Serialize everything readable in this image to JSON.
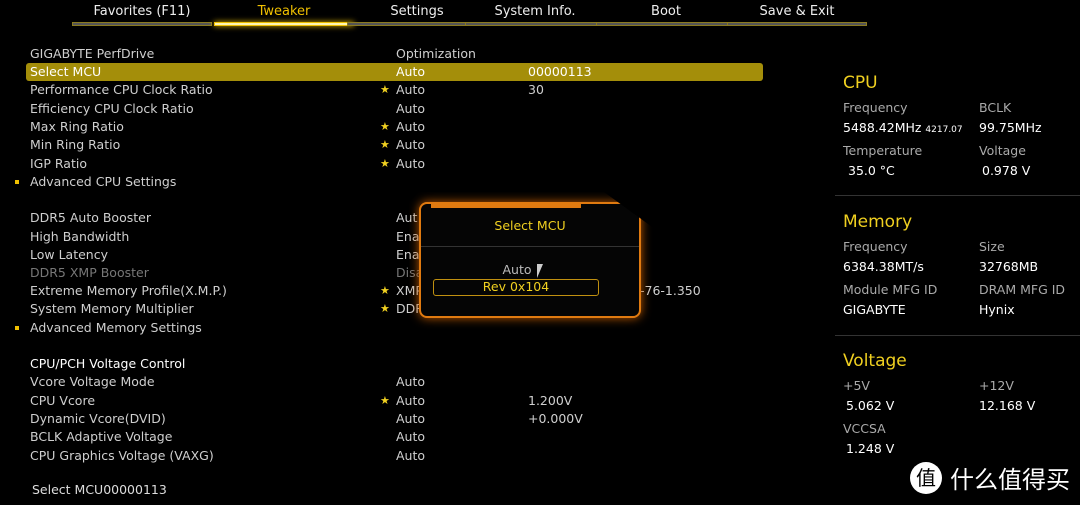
{
  "tabs": [
    {
      "label": "Favorites (F11)"
    },
    {
      "label": "Tweaker",
      "active": true
    },
    {
      "label": "Settings"
    },
    {
      "label": "System Info."
    },
    {
      "label": "Boot"
    },
    {
      "label": "Save & Exit"
    }
  ],
  "rows": [
    {
      "label": "GIGABYTE PerfDrive",
      "value": "Optimization"
    },
    {
      "label": "Select MCU",
      "value": "Auto",
      "extra": "00000113"
    },
    {
      "label": "Performance CPU Clock Ratio",
      "star": "★",
      "value": "Auto",
      "extra": "30"
    },
    {
      "label": "Efficiency CPU Clock Ratio",
      "value": "Auto"
    },
    {
      "label": "Max Ring Ratio",
      "star": "★",
      "value": "Auto"
    },
    {
      "label": "Min Ring Ratio",
      "star": "★",
      "value": "Auto"
    },
    {
      "label": "IGP Ratio",
      "star": "★",
      "value": "Auto"
    },
    {
      "label": "Advanced CPU Settings"
    },
    {
      "label": "DDR5 Auto Booster",
      "value": "Aut"
    },
    {
      "label": "High Bandwidth",
      "value": "Ena"
    },
    {
      "label": "Low Latency",
      "value": "Ena"
    },
    {
      "label": "DDR5 XMP Booster",
      "value": "Disa"
    },
    {
      "label": "Extreme Memory Profile(X.M.P.)",
      "star": "★",
      "value": "XMP",
      "extra": "-76-1.350"
    },
    {
      "label": "System Memory Multiplier",
      "star": "★",
      "value": "DDR"
    },
    {
      "label": "Advanced Memory Settings"
    },
    {
      "label": "CPU/PCH Voltage Control"
    },
    {
      "label": "Vcore Voltage Mode",
      "value": "Auto"
    },
    {
      "label": "CPU Vcore",
      "star": "★",
      "value": "Auto",
      "extra": "1.200V"
    },
    {
      "label": "Dynamic Vcore(DVID)",
      "value": "Auto",
      "extra": "+0.000V"
    },
    {
      "label": "BCLK Adaptive Voltage",
      "value": "Auto"
    },
    {
      "label": "CPU Graphics Voltage (VAXG)",
      "value": "Auto"
    }
  ],
  "status": "Select MCU00000113",
  "popup": {
    "title": "Select MCU",
    "options": [
      "Auto",
      "Rev 0x104"
    ]
  },
  "side": {
    "cpu": {
      "title": "CPU",
      "freq_label": "Frequency",
      "freq": "5488.42MHz",
      "freq_sub": "4217.07",
      "bclk_label": "BCLK",
      "bclk": "99.75MHz",
      "temp_label": "Temperature",
      "temp": "35.0 °C",
      "volt_label": "Voltage",
      "volt": "0.978 V"
    },
    "memory": {
      "title": "Memory",
      "freq_label": "Frequency",
      "freq": "6384.38MT/s",
      "size_label": "Size",
      "size": "32768MB",
      "mod_label": "Module MFG ID",
      "mod": "GIGABYTE",
      "dram_label": "DRAM MFG ID",
      "dram": "Hynix"
    },
    "voltage": {
      "title": "Voltage",
      "v5_label": "+5V",
      "v5": "5.062 V",
      "v12_label": "+12V",
      "v12": "12.168 V",
      "vccsa_label": "VCCSA",
      "vccsa": "1.248 V"
    }
  },
  "watermark": {
    "badge": "值",
    "text": "什么值得买"
  },
  "colors": {
    "accent": "#f0c000",
    "selected_row": "#a48e0a",
    "popup_border": "#e07a10"
  }
}
